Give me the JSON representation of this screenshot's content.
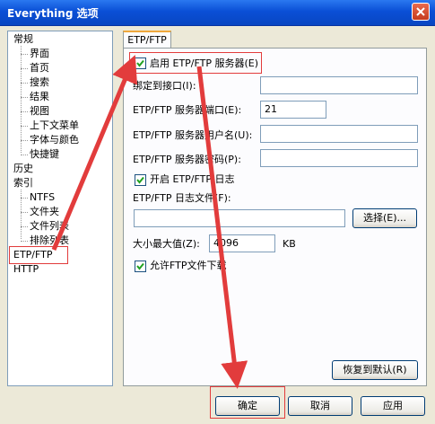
{
  "window": {
    "title": "Everything 选项"
  },
  "tree": {
    "items": [
      {
        "label": "常规",
        "level": 0
      },
      {
        "label": "界面",
        "level": 1
      },
      {
        "label": "首页",
        "level": 1
      },
      {
        "label": "搜索",
        "level": 1
      },
      {
        "label": "结果",
        "level": 1
      },
      {
        "label": "视图",
        "level": 1
      },
      {
        "label": "上下文菜单",
        "level": 1
      },
      {
        "label": "字体与颜色",
        "level": 1
      },
      {
        "label": "快捷键",
        "level": 1
      },
      {
        "label": "历史",
        "level": 0
      },
      {
        "label": "索引",
        "level": 0
      },
      {
        "label": "NTFS",
        "level": 1
      },
      {
        "label": "文件夹",
        "level": 1
      },
      {
        "label": "文件列表",
        "level": 1
      },
      {
        "label": "排除列表",
        "level": 1
      },
      {
        "label": "ETP/FTP",
        "level": 0,
        "selected": true
      },
      {
        "label": "HTTP",
        "level": 0
      }
    ]
  },
  "tab": {
    "label": "ETP/FTP"
  },
  "form": {
    "enable_server": {
      "label": "启用 ETP/FTP 服务器(E)",
      "checked": true
    },
    "bind_interface": {
      "label": "绑定到接口(I):",
      "value": ""
    },
    "port": {
      "label": "ETP/FTP 服务器端口(E):",
      "value": "21"
    },
    "username": {
      "label": "ETP/FTP 服务器用户名(U):",
      "value": ""
    },
    "password": {
      "label": "ETP/FTP 服务器密码(P):",
      "value": ""
    },
    "enable_log": {
      "label": "开启 ETP/FTP 日志",
      "checked": true
    },
    "log_file": {
      "label": "ETP/FTP 日志文件(F):",
      "value": ""
    },
    "browse_button": "选择(E)...",
    "max_size": {
      "label": "大小最大值(Z):",
      "value": "4096",
      "unit": "KB"
    },
    "allow_download": {
      "label": "允许FTP文件下载",
      "checked": true
    },
    "restore_default_button": "恢复到默认(R)"
  },
  "footer": {
    "ok_button": "确定",
    "cancel_button": "取消",
    "apply_button": "应用"
  },
  "colors": {
    "annotation": "#e23c3c",
    "titlebar": "#0a4fd6"
  }
}
